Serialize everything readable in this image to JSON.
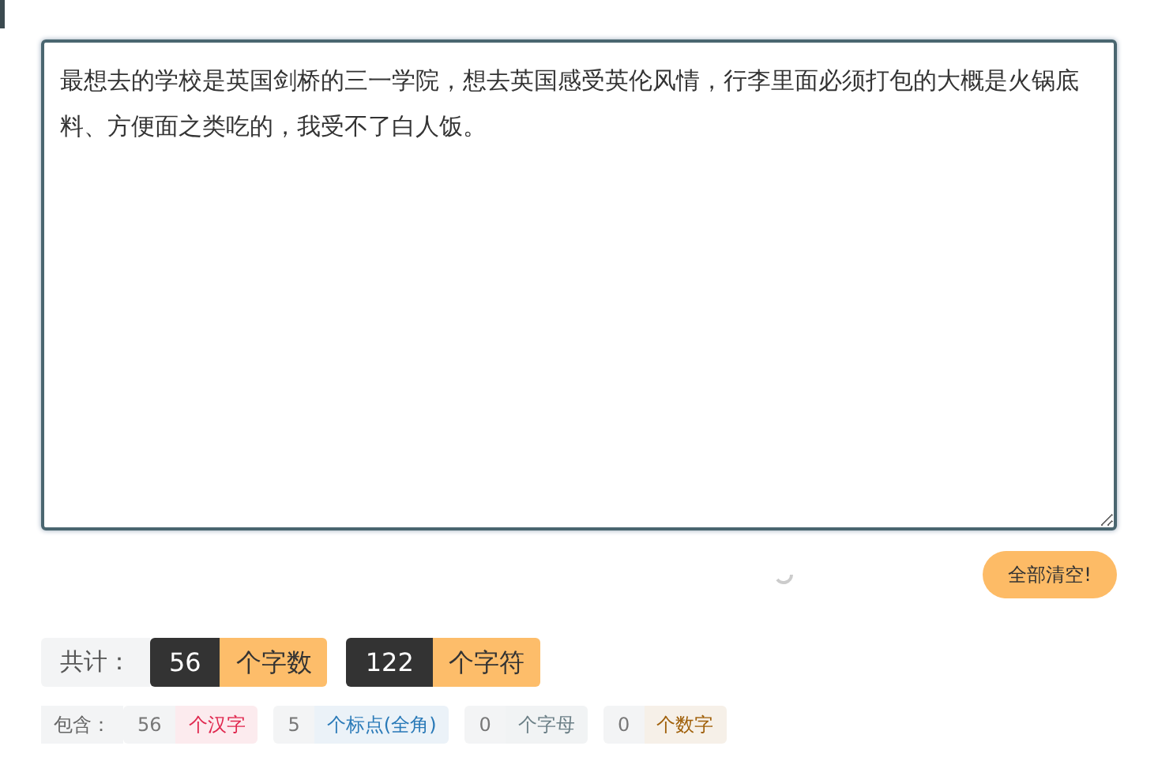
{
  "editor": {
    "value": "最想去的学校是英国剑桥的三一学院，想去英国感受英伦风情，行李里面必须打包的大概是火锅底料、方便面之类吃的，我受不了白人饭。"
  },
  "clear_button": {
    "label": "全部清空!"
  },
  "totals": {
    "label": "共计：",
    "items": [
      {
        "count": "56",
        "unit": "个字数"
      },
      {
        "count": "122",
        "unit": "个字符"
      }
    ]
  },
  "breakdown": {
    "label": "包含：",
    "items": [
      {
        "count": "56",
        "unit": "个汉字",
        "color": "#e0284f"
      },
      {
        "count": "5",
        "unit": "个标点(全角)",
        "color": "#2a7ab8"
      },
      {
        "count": "0",
        "unit": "个字母",
        "color": "#6b7f86"
      },
      {
        "count": "0",
        "unit": "个数字",
        "color": "#a0600a"
      }
    ]
  }
}
